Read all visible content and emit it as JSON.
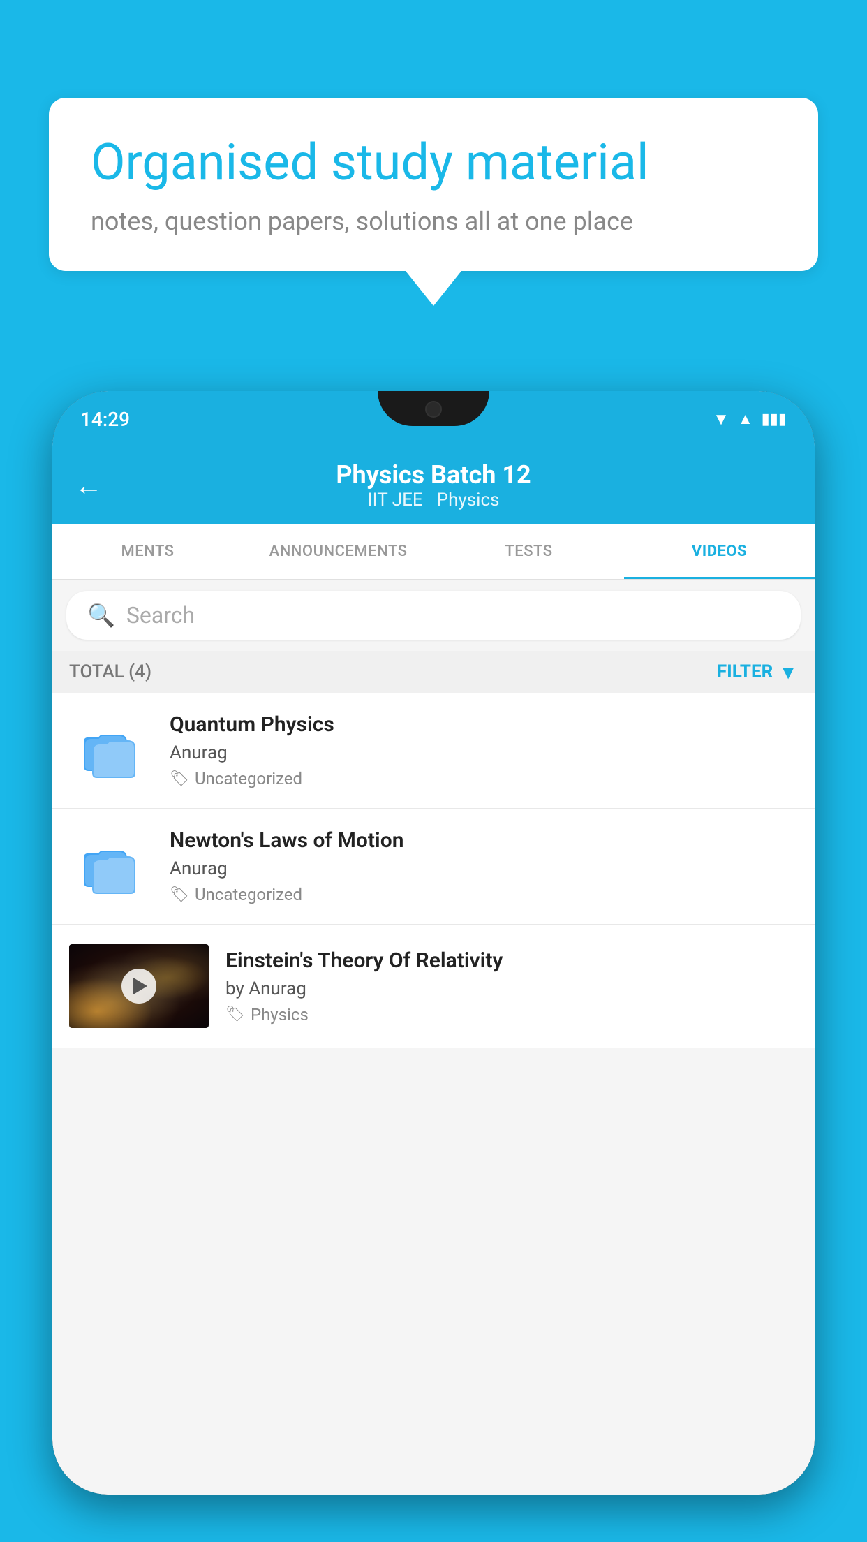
{
  "background_color": "#1ab8e8",
  "speech_bubble": {
    "title": "Organised study material",
    "subtitle": "notes, question papers, solutions all at one place"
  },
  "phone": {
    "status_bar": {
      "time": "14:29",
      "wifi": "▼",
      "signal": "▲",
      "battery": "▮"
    },
    "header": {
      "back_label": "←",
      "title": "Physics Batch 12",
      "subtitle_left": "IIT JEE",
      "subtitle_right": "Physics"
    },
    "tabs": [
      {
        "label": "MENTS",
        "active": false
      },
      {
        "label": "ANNOUNCEMENTS",
        "active": false
      },
      {
        "label": "TESTS",
        "active": false
      },
      {
        "label": "VIDEOS",
        "active": true
      }
    ],
    "search": {
      "placeholder": "Search"
    },
    "filter_bar": {
      "total_label": "TOTAL (4)",
      "filter_label": "FILTER"
    },
    "videos": [
      {
        "title": "Quantum Physics",
        "author": "Anurag",
        "tag": "Uncategorized",
        "has_thumbnail": false
      },
      {
        "title": "Newton's Laws of Motion",
        "author": "Anurag",
        "tag": "Uncategorized",
        "has_thumbnail": false
      },
      {
        "title": "Einstein's Theory Of Relativity",
        "author": "by Anurag",
        "tag": "Physics",
        "has_thumbnail": true
      }
    ]
  }
}
